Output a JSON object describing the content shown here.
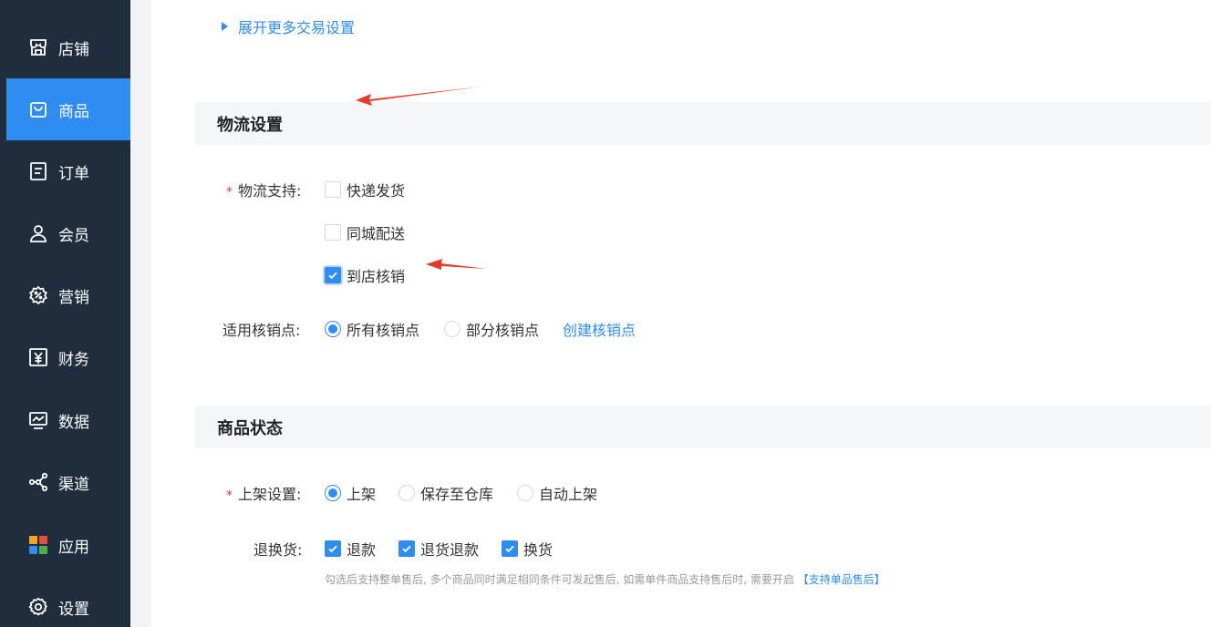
{
  "sidebar": {
    "items": [
      {
        "label": "店铺",
        "icon": "store-icon"
      },
      {
        "label": "商品",
        "icon": "shopping-bag-icon",
        "active": true
      },
      {
        "label": "订单",
        "icon": "order-icon"
      },
      {
        "label": "会员",
        "icon": "member-icon"
      },
      {
        "label": "营销",
        "icon": "marketing-icon"
      },
      {
        "label": "财务",
        "icon": "finance-icon"
      },
      {
        "label": "数据",
        "icon": "data-icon"
      },
      {
        "label": "渠道",
        "icon": "channel-icon"
      },
      {
        "label": "应用",
        "icon": "apps-icon"
      },
      {
        "label": "设置",
        "icon": "settings-icon"
      }
    ]
  },
  "main": {
    "expand_more": "展开更多交易设置",
    "logistics": {
      "title": "物流设置",
      "support_label": "物流支持:",
      "options": [
        {
          "label": "快递发货",
          "checked": false
        },
        {
          "label": "同城配送",
          "checked": false
        },
        {
          "label": "到店核销",
          "checked": true
        }
      ],
      "points_label": "适用核销点:",
      "points_options": [
        {
          "label": "所有核销点",
          "selected": true
        },
        {
          "label": "部分核销点",
          "selected": false
        }
      ],
      "create_point_link": "创建核销点"
    },
    "status": {
      "title": "商品状态",
      "listing_label": "上架设置:",
      "listing_options": [
        {
          "label": "上架",
          "selected": true
        },
        {
          "label": "保存至仓库",
          "selected": false
        },
        {
          "label": "自动上架",
          "selected": false
        }
      ],
      "return_label": "退换货:",
      "return_options": [
        {
          "label": "退款",
          "checked": true
        },
        {
          "label": "退货退款",
          "checked": true
        },
        {
          "label": "换货",
          "checked": true
        }
      ],
      "hint": "勾选后支持整单售后, 多个商品同时满足相同条件可发起售后, 如需单件商品支持售后时, 需要开启",
      "hint_link": "【支持单品售后】"
    }
  },
  "colors": {
    "sidebar_bg": "#1f2d3d",
    "accent": "#2f8cf0",
    "required": "#e53a2e",
    "annotation_arrow": "#e53a2e"
  }
}
